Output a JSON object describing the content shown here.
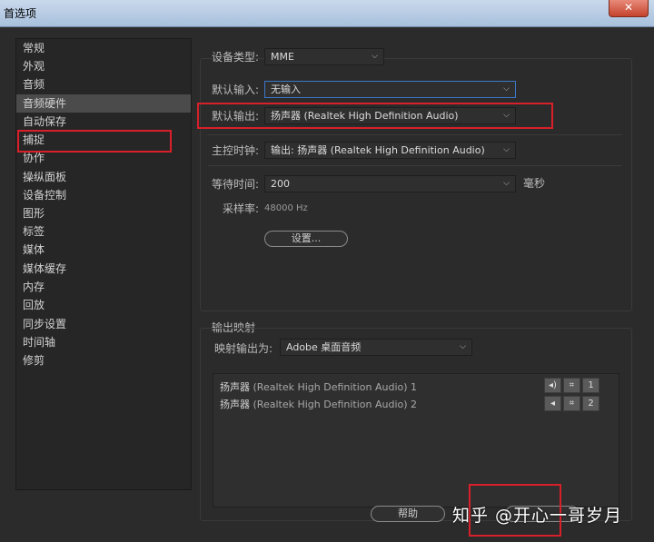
{
  "window": {
    "title": "首选项",
    "close_glyph": "✕"
  },
  "sidebar": {
    "items": [
      {
        "label": "常规"
      },
      {
        "label": "外观"
      },
      {
        "label": "音频"
      },
      {
        "label": "音频硬件",
        "selected": true
      },
      {
        "label": "自动保存"
      },
      {
        "label": "捕捉"
      },
      {
        "label": "协作"
      },
      {
        "label": "操纵面板"
      },
      {
        "label": "设备控制"
      },
      {
        "label": "图形"
      },
      {
        "label": "标签"
      },
      {
        "label": "媒体"
      },
      {
        "label": "媒体缓存"
      },
      {
        "label": "内存"
      },
      {
        "label": "回放"
      },
      {
        "label": "同步设置"
      },
      {
        "label": "时间轴"
      },
      {
        "label": "修剪"
      }
    ]
  },
  "audio_hardware": {
    "device_type_label": "设备类型:",
    "device_type_value": "MME",
    "default_input_label": "默认输入:",
    "default_input_value": "无输入",
    "default_output_label": "默认输出:",
    "default_output_value": "扬声器 (Realtek High Definition Audio)",
    "master_clock_label": "主控时钟:",
    "master_clock_value": "输出: 扬声器 (Realtek High Definition Audio)",
    "latency_label": "等待时间:",
    "latency_value": "200",
    "latency_unit": "毫秒",
    "sample_rate_label": "采样率:",
    "sample_rate_value": "48000 Hz",
    "settings_button": "设置..."
  },
  "output_mapping": {
    "section_title": "输出映射",
    "map_output_label": "映射输出为:",
    "map_output_value": "Adobe 桌面音频",
    "rows": [
      {
        "name": "扬声器",
        "detail": "(Realtek High Definition Audio) 1",
        "channel": "1"
      },
      {
        "name": "扬声器",
        "detail": "(Realtek High Definition Audio) 2",
        "channel": "2"
      }
    ]
  },
  "footer": {
    "help_button": "帮助"
  },
  "watermark": "知乎 @开心一哥岁月",
  "colors": {
    "highlight_red": "#d8202a",
    "focus_blue": "#3c78c8",
    "selected_bg": "#4b4b4b"
  },
  "icons": [
    "close-icon",
    "chevron-down-icon",
    "speaker-icon",
    "mute-icon",
    "frame-icon"
  ]
}
